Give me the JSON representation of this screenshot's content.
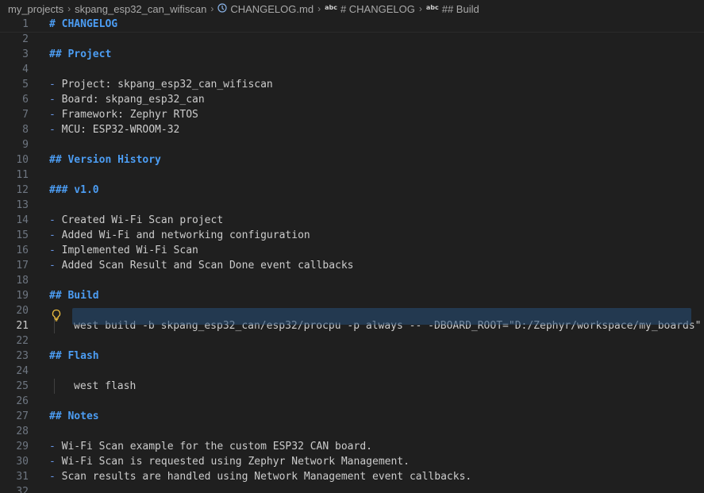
{
  "breadcrumb": {
    "items": [
      {
        "label": "my_projects",
        "icon": ""
      },
      {
        "label": "skpang_esp32_can_wifiscan",
        "icon": ""
      },
      {
        "label": "CHANGELOG.md",
        "icon": "markdown-info-icon"
      },
      {
        "label": "# CHANGELOG",
        "icon": "abc-symbol-icon"
      },
      {
        "label": "## Build",
        "icon": "abc-symbol-icon"
      }
    ],
    "abc_label": "abc"
  },
  "editor": {
    "active_line": 21,
    "lines": [
      {
        "n": "1",
        "text": "# CHANGELOG",
        "kind": "heading"
      },
      {
        "n": "2",
        "text": "",
        "kind": "plain"
      },
      {
        "n": "3",
        "text": "## Project",
        "kind": "heading"
      },
      {
        "n": "4",
        "text": "",
        "kind": "plain"
      },
      {
        "n": "5",
        "text": "Project: skpang_esp32_can_wifiscan",
        "kind": "bullet"
      },
      {
        "n": "6",
        "text": "Board: skpang_esp32_can",
        "kind": "bullet"
      },
      {
        "n": "7",
        "text": "Framework: Zephyr RTOS",
        "kind": "bullet"
      },
      {
        "n": "8",
        "text": "MCU: ESP32-WROOM-32",
        "kind": "bullet"
      },
      {
        "n": "9",
        "text": "",
        "kind": "plain"
      },
      {
        "n": "10",
        "text": "## Version History",
        "kind": "heading"
      },
      {
        "n": "11",
        "text": "",
        "kind": "plain"
      },
      {
        "n": "12",
        "text": "### v1.0",
        "kind": "heading"
      },
      {
        "n": "13",
        "text": "",
        "kind": "plain"
      },
      {
        "n": "14",
        "text": "Created Wi-Fi Scan project",
        "kind": "bullet"
      },
      {
        "n": "15",
        "text": "Added Wi-Fi and networking configuration",
        "kind": "bullet"
      },
      {
        "n": "16",
        "text": "Implemented Wi-Fi Scan",
        "kind": "bullet"
      },
      {
        "n": "17",
        "text": "Added Scan Result and Scan Done event callbacks",
        "kind": "bullet"
      },
      {
        "n": "18",
        "text": "",
        "kind": "plain"
      },
      {
        "n": "19",
        "text": "## Build",
        "kind": "heading"
      },
      {
        "n": "20",
        "text": "",
        "kind": "plain"
      },
      {
        "n": "21",
        "text": "west build -b skpang_esp32_can/esp32/procpu -p always -- -DBOARD_ROOT=\"D:/Zephyr/workspace/my_boards\"",
        "kind": "code-selected"
      },
      {
        "n": "22",
        "text": "",
        "kind": "plain"
      },
      {
        "n": "23",
        "text": "## Flash",
        "kind": "heading"
      },
      {
        "n": "24",
        "text": "",
        "kind": "plain"
      },
      {
        "n": "25",
        "text": "west flash",
        "kind": "code"
      },
      {
        "n": "26",
        "text": "",
        "kind": "plain"
      },
      {
        "n": "27",
        "text": "## Notes",
        "kind": "heading"
      },
      {
        "n": "28",
        "text": "",
        "kind": "plain"
      },
      {
        "n": "29",
        "text": "Wi-Fi Scan example for the custom ESP32 CAN board.",
        "kind": "bullet"
      },
      {
        "n": "30",
        "text": "Wi-Fi Scan is requested using Zephyr Network Management.",
        "kind": "bullet"
      },
      {
        "n": "31",
        "text": "Scan results are handled using Network Management event callbacks.",
        "kind": "bullet"
      },
      {
        "n": "32",
        "text": "",
        "kind": "plain"
      }
    ]
  },
  "bullet_marker": "- ",
  "lightbulb": {
    "icon": "lightbulb-icon"
  },
  "colors": {
    "background": "#1f1f1f",
    "heading": "#4c9df3",
    "bullet_marker": "#6796e6",
    "text": "#cccccc",
    "line_number": "#6e7681",
    "selection": "#264f78",
    "lightbulb": "#f0c040"
  }
}
